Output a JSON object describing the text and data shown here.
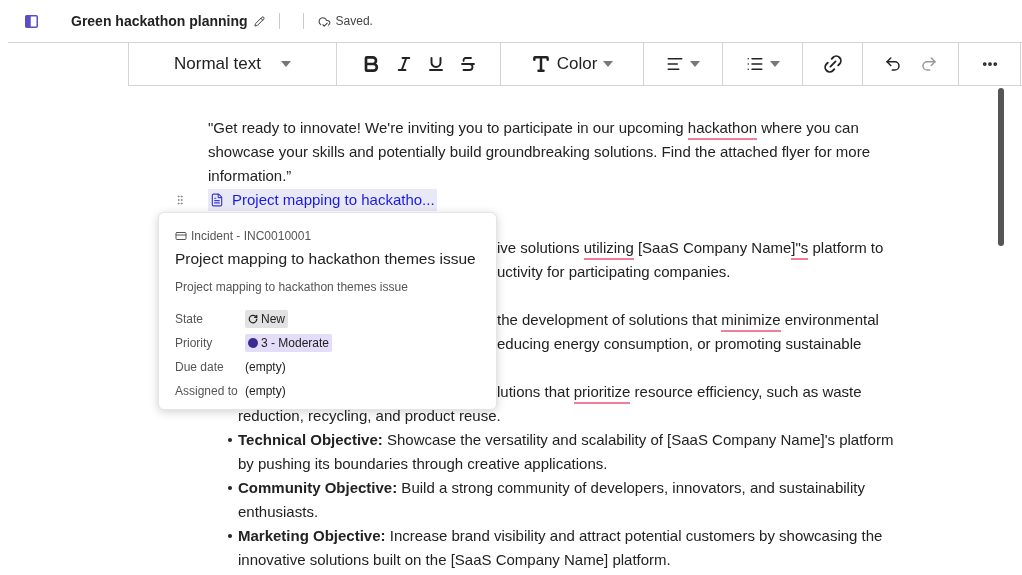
{
  "header": {
    "title": "Green hackathon planning",
    "status": "Saved."
  },
  "toolbar": {
    "text_style": "Normal text",
    "color_label": "Color"
  },
  "document": {
    "intro": [
      [
        {
          "text": "\"Get ready to innovate! We're inviting you to participate in our upcoming ",
          "flagged": false
        },
        {
          "text": "hackathon",
          "flagged": true
        },
        {
          "text": " where you can",
          "flagged": false
        }
      ],
      [
        {
          "text": "showcase your skills and potentially build groundbreaking solutions. Find the attached flyer for more",
          "flagged": false
        }
      ],
      [
        {
          "text": "information.”",
          "flagged": false
        }
      ]
    ],
    "link_chip": "Project mapping to hackatho...",
    "blocks": [
      {
        "kind": "fragment",
        "lines": [
          {
            "covered": true,
            "segments": [
              {
                "text": "ive solutions ",
                "flagged": false
              },
              {
                "text": "utilizing",
                "flagged": true
              },
              {
                "text": " [SaaS Company Name",
                "flagged": false
              },
              {
                "text": "]\"s",
                "flagged": true
              },
              {
                "text": " platform to",
                "flagged": false
              }
            ]
          },
          {
            "covered": true,
            "segments": [
              {
                "text": "uctivity for participating companies.",
                "flagged": false
              }
            ]
          }
        ]
      },
      {
        "kind": "fragment",
        "lines": [
          {
            "covered": true,
            "segments": [
              {
                "text": "the development of solutions that ",
                "flagged": false
              },
              {
                "text": "minimize",
                "flagged": true
              },
              {
                "text": " environmental",
                "flagged": false
              }
            ]
          },
          {
            "covered": true,
            "segments": [
              {
                "text": "educing energy consumption, or promoting sustainable",
                "flagged": false
              }
            ]
          }
        ]
      },
      {
        "kind": "fragment",
        "lines": [
          {
            "covered": true,
            "segments": [
              {
                "text": "lutions that ",
                "flagged": false
              },
              {
                "text": "prioritize",
                "flagged": true
              },
              {
                "text": " resource efficiency, such as waste",
                "flagged": false
              }
            ]
          },
          {
            "covered": false,
            "segments": [
              {
                "text": "reduction, recycling, and product reuse.",
                "flagged": false
              }
            ]
          }
        ]
      },
      {
        "kind": "bullet",
        "lines": [
          {
            "segments": [
              {
                "text": "**Technical Objective:** Showcase the versatility and scalability of [SaaS Company Name]'s platform",
                "flagged": false
              }
            ]
          },
          {
            "segments": [
              {
                "text": "by pushing its boundaries through creative applications.",
                "flagged": false
              }
            ]
          }
        ]
      },
      {
        "kind": "bullet",
        "lines": [
          {
            "segments": [
              {
                "text": "**Community Objective:** Build a strong community of developers, innovators, and sustainability",
                "flagged": false
              }
            ]
          },
          {
            "segments": [
              {
                "text": "enthusiasts.",
                "flagged": false
              }
            ]
          }
        ]
      },
      {
        "kind": "bullet",
        "lines": [
          {
            "segments": [
              {
                "text": "**Marketing Objective:** Increase brand visibility and attract potential customers by showcasing the",
                "flagged": false
              }
            ]
          },
          {
            "segments": [
              {
                "text": "innovative solutions built on the [SaaS Company Name] platform.",
                "flagged": false
              }
            ]
          }
        ]
      }
    ]
  },
  "popover": {
    "record": "Incident - INC0010001",
    "title": "Project mapping to hackathon themes issue",
    "description": "Project mapping to hackathon themes issue",
    "fields": [
      {
        "label": "State",
        "value": "New",
        "kind": "state"
      },
      {
        "label": "Priority",
        "value": "3 - Moderate",
        "kind": "priority",
        "color": "#3b2a8f"
      },
      {
        "label": "Due date",
        "value": "(empty)",
        "kind": "plain"
      },
      {
        "label": "Assigned to",
        "value": "(empty)",
        "kind": "plain"
      }
    ]
  }
}
